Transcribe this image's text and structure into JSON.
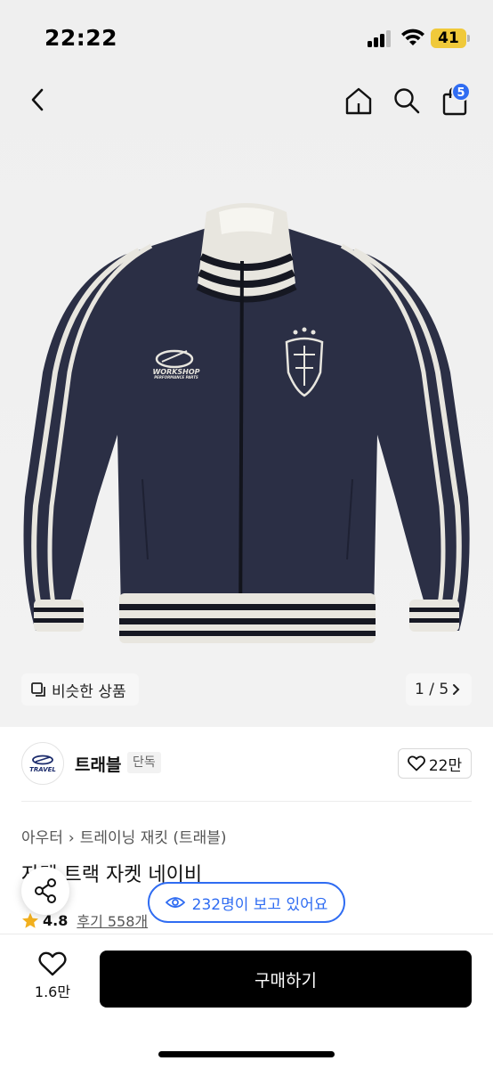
{
  "status_bar": {
    "time": "22:22",
    "battery": "41"
  },
  "nav": {
    "cart_count": "5"
  },
  "product_image": {
    "brand_print": "WORKSHOP",
    "brand_print_sub": "PERFORMANCE PARTS"
  },
  "image_controls": {
    "similar_label": "비슷한 상품",
    "pager": "1 / 5"
  },
  "brand": {
    "logo_text": "TRAVEL",
    "name": "트래블",
    "badge": "단독",
    "likes": "22만"
  },
  "category": {
    "parent": "아우터",
    "child": "트레이닝 재킷 (트래블)"
  },
  "product": {
    "title": "자켓 트랙 자켓 네이비",
    "rating": "4.8",
    "review_label": "후기 558개"
  },
  "viewers": {
    "label": "232명이 보고 있어요"
  },
  "bottom_bar": {
    "heart_count": "1.6만",
    "buy_label": "구매하기"
  },
  "colors": {
    "accent": "#2f6cf2",
    "jacket": "#2b2f45",
    "star": "#f2b01e"
  },
  "icons": [
    "back-icon",
    "home-icon",
    "search-icon",
    "cart-icon",
    "similar-icon",
    "chevron-right-icon",
    "heart-icon",
    "share-icon",
    "eye-icon",
    "star-icon"
  ]
}
